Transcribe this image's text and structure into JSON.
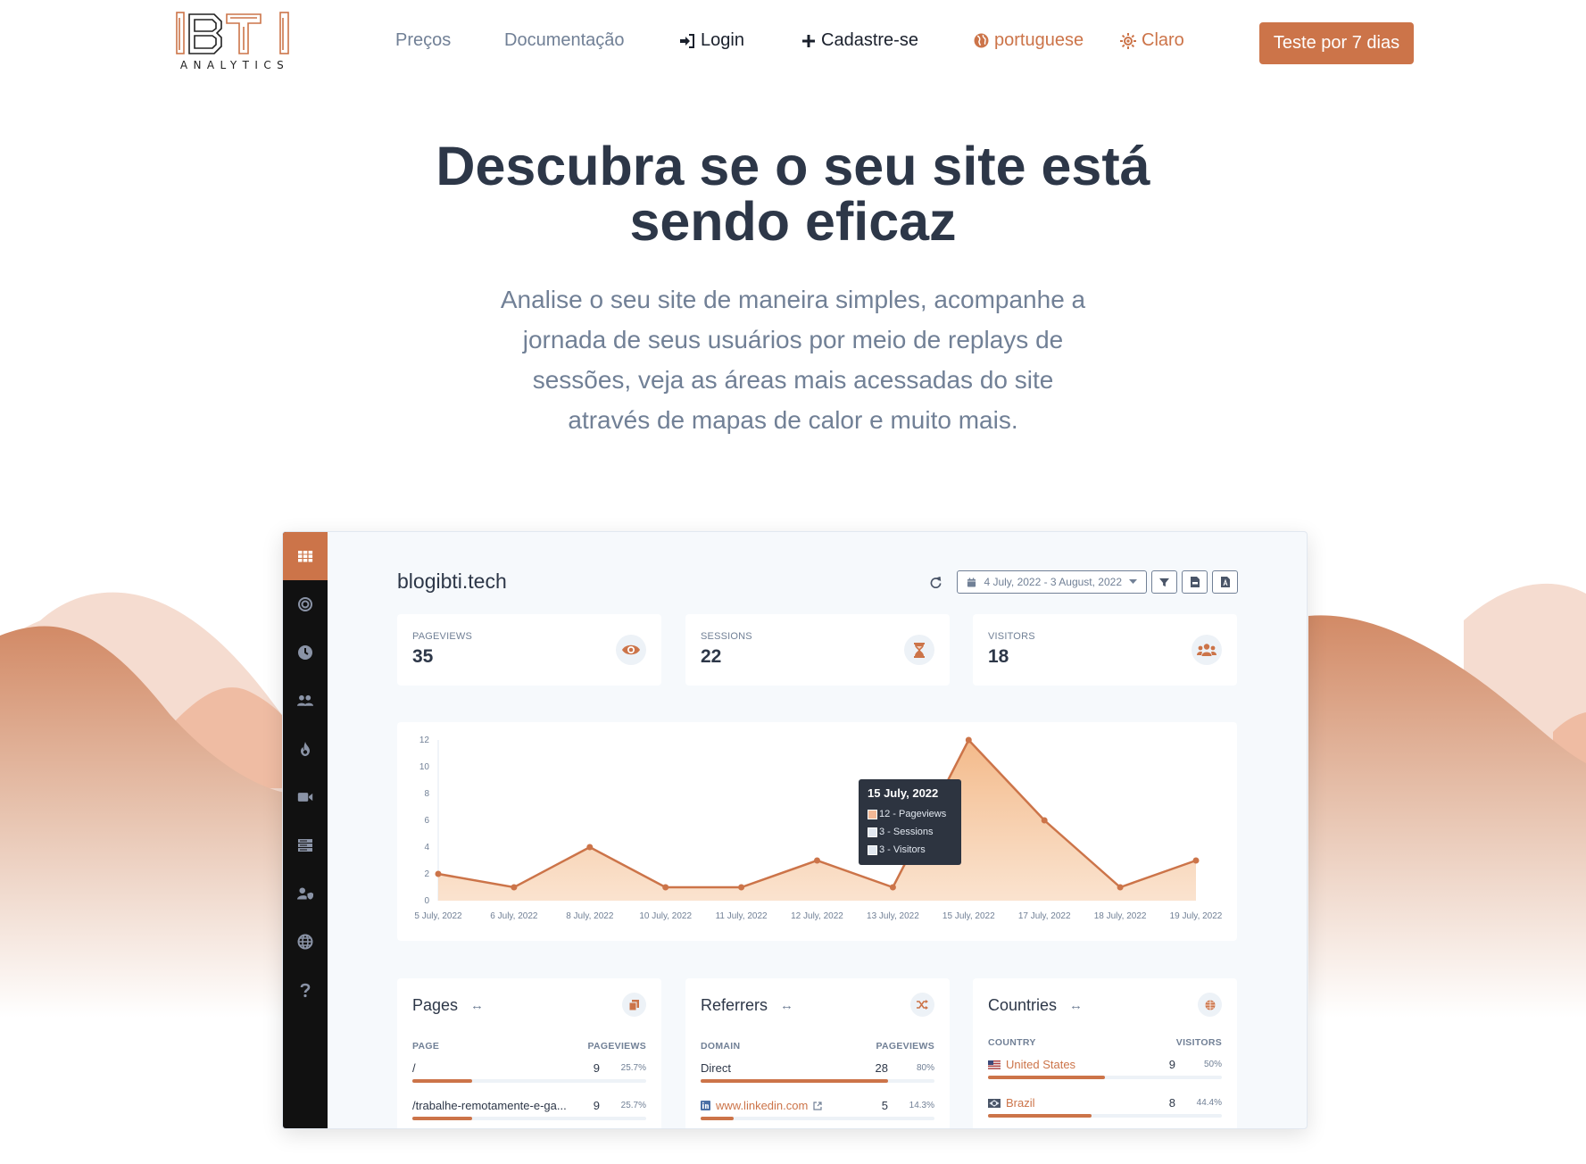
{
  "header": {
    "logo_text": "ANALYTICS",
    "nav": {
      "pricing": "Preços",
      "docs": "Documentação",
      "login": "Login",
      "signup": "Cadastre-se",
      "language": "portuguese",
      "theme": "Claro"
    },
    "cta": "Teste por 7 dias"
  },
  "hero": {
    "title_line1": "Descubra se o seu site está",
    "title_line2": "sendo eficaz",
    "subtitle": "Analise o seu site de maneira simples, acompanhe a jornada de seus usuários por meio de replays de sessões, veja as áreas mais acessadas do site através de mapas de calor e muito mais."
  },
  "colors": {
    "accent": "#cc7449",
    "sidebar_bg": "#111111",
    "text_dark": "#2d3748",
    "text_muted": "#718096"
  },
  "dashboard": {
    "sidebar_icons": [
      "grid-icon",
      "target-icon",
      "clock-icon",
      "users-icon",
      "fire-icon",
      "video-icon",
      "server-icon",
      "user-shield-icon",
      "globe-icon",
      "question-icon"
    ],
    "site_name": "blogibti.tech",
    "date_range": "4 July, 2022 - 3 August, 2022",
    "stats": [
      {
        "label": "PAGEVIEWS",
        "value": "35",
        "icon": "eye-icon"
      },
      {
        "label": "SESSIONS",
        "value": "22",
        "icon": "hourglass-icon"
      },
      {
        "label": "VISITORS",
        "value": "18",
        "icon": "users-icon"
      }
    ],
    "tooltip": {
      "title": "15 July, 2022",
      "rows": [
        "12 - Pageviews",
        "3 - Sessions",
        "3 - Visitors"
      ]
    },
    "pages": {
      "title": "Pages",
      "col1": "PAGE",
      "col2": "PAGEVIEWS",
      "rows": [
        {
          "label": "/",
          "value": "9",
          "pct": "25.7%",
          "fraction": 0.257
        },
        {
          "label": "/trabalhe-remotamente-e-ga...",
          "value": "9",
          "pct": "25.7%",
          "fraction": 0.257
        }
      ]
    },
    "referrers": {
      "title": "Referrers",
      "col1": "DOMAIN",
      "col2": "PAGEVIEWS",
      "rows": [
        {
          "label": "Direct",
          "value": "28",
          "pct": "80%",
          "fraction": 0.8
        },
        {
          "label": "www.linkedin.com",
          "value": "5",
          "pct": "14.3%",
          "fraction": 0.143
        }
      ]
    },
    "countries": {
      "title": "Countries",
      "col1": "COUNTRY",
      "col2": "VISITORS",
      "rows": [
        {
          "label": "United States",
          "value": "9",
          "pct": "50%",
          "fraction": 0.5
        },
        {
          "label": "Brazil",
          "value": "8",
          "pct": "44.4%",
          "fraction": 0.444
        }
      ]
    }
  },
  "chart_data": {
    "type": "area",
    "title": "",
    "xlabel": "",
    "ylabel": "",
    "categories": [
      "5 July, 2022",
      "6 July, 2022",
      "8 July, 2022",
      "10 July, 2022",
      "11 July, 2022",
      "12 July, 2022",
      "13 July, 2022",
      "15 July, 2022",
      "17 July, 2022",
      "18 July, 2022",
      "19 July, 2022"
    ],
    "series": [
      {
        "name": "Pageviews",
        "values": [
          2,
          1,
          4,
          1,
          1,
          3,
          1,
          12,
          6,
          1,
          3
        ]
      }
    ],
    "yticks": [
      0,
      2,
      4,
      6,
      8,
      10,
      12
    ],
    "ylim": [
      0,
      12
    ],
    "grid": false,
    "legend": "none"
  }
}
